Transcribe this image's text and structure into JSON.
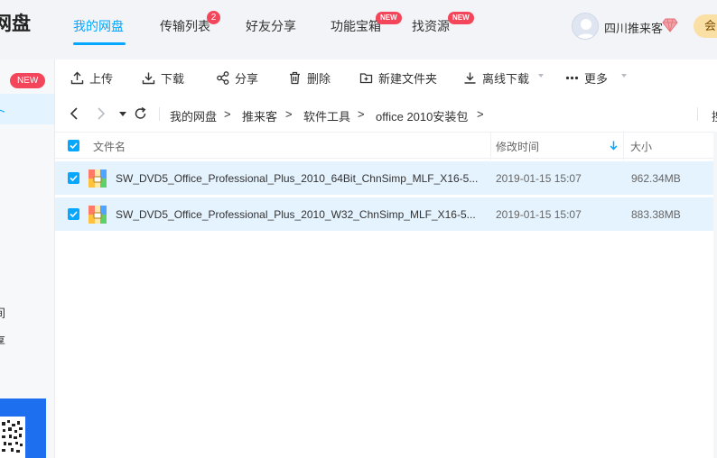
{
  "header": {
    "brand": "网盘",
    "nav": [
      {
        "label": "我的网盘",
        "active": true
      },
      {
        "label": "传输列表",
        "badge": "2"
      },
      {
        "label": "好友分享"
      },
      {
        "label": "功能宝箱",
        "badge": "NEW"
      },
      {
        "label": "找资源",
        "badge": "NEW"
      }
    ],
    "user": {
      "name": "四川推来客",
      "avatar": "avatar-default-icon",
      "vip": "diamond-icon"
    },
    "member_label": "会员"
  },
  "sidebar": {
    "new_badge": "NEW",
    "active_label": "ト",
    "texts": [
      "间",
      "享"
    ]
  },
  "toolbar": {
    "upload": "上传",
    "download": "下载",
    "share": "分享",
    "delete": "删除",
    "new_folder": "新建文件夹",
    "offline_download": "离线下载",
    "more": "更多"
  },
  "path": {
    "crumbs": [
      "我的网盘",
      "推来客",
      "软件工具",
      "office 2010安装包"
    ],
    "separator": ">",
    "right_text": "搜"
  },
  "table": {
    "columns": {
      "name": "文件名",
      "modified": "修改时间",
      "size": "大小"
    },
    "sort_column": "modified",
    "rows": [
      {
        "name": "SW_DVD5_Office_Professional_Plus_2010_64Bit_ChnSimp_MLF_X16-5...",
        "modified": "2019-01-15 15:07",
        "size": "962.34MB",
        "selected": true,
        "icon": "archive-icon"
      },
      {
        "name": "SW_DVD5_Office_Professional_Plus_2010_W32_ChnSimp_MLF_X16-5...",
        "modified": "2019-01-15 15:07",
        "size": "883.38MB",
        "selected": true,
        "icon": "archive-icon"
      }
    ]
  },
  "colors": {
    "accent": "#06a7ff",
    "badge": "#f4465b",
    "selected_row": "#e5f3ff",
    "member": "#fbe0a6"
  }
}
